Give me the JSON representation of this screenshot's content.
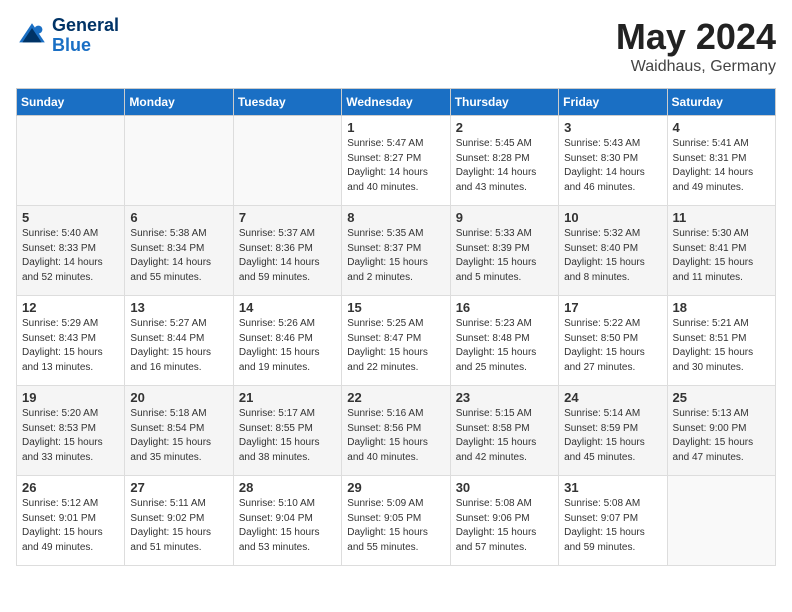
{
  "header": {
    "logo_line1": "General",
    "logo_line2": "Blue",
    "month": "May 2024",
    "location": "Waidhaus, Germany"
  },
  "weekdays": [
    "Sunday",
    "Monday",
    "Tuesday",
    "Wednesday",
    "Thursday",
    "Friday",
    "Saturday"
  ],
  "weeks": [
    [
      {
        "day": "",
        "sunrise": "",
        "sunset": "",
        "daylight": ""
      },
      {
        "day": "",
        "sunrise": "",
        "sunset": "",
        "daylight": ""
      },
      {
        "day": "",
        "sunrise": "",
        "sunset": "",
        "daylight": ""
      },
      {
        "day": "1",
        "sunrise": "Sunrise: 5:47 AM",
        "sunset": "Sunset: 8:27 PM",
        "daylight": "Daylight: 14 hours and 40 minutes."
      },
      {
        "day": "2",
        "sunrise": "Sunrise: 5:45 AM",
        "sunset": "Sunset: 8:28 PM",
        "daylight": "Daylight: 14 hours and 43 minutes."
      },
      {
        "day": "3",
        "sunrise": "Sunrise: 5:43 AM",
        "sunset": "Sunset: 8:30 PM",
        "daylight": "Daylight: 14 hours and 46 minutes."
      },
      {
        "day": "4",
        "sunrise": "Sunrise: 5:41 AM",
        "sunset": "Sunset: 8:31 PM",
        "daylight": "Daylight: 14 hours and 49 minutes."
      }
    ],
    [
      {
        "day": "5",
        "sunrise": "Sunrise: 5:40 AM",
        "sunset": "Sunset: 8:33 PM",
        "daylight": "Daylight: 14 hours and 52 minutes."
      },
      {
        "day": "6",
        "sunrise": "Sunrise: 5:38 AM",
        "sunset": "Sunset: 8:34 PM",
        "daylight": "Daylight: 14 hours and 55 minutes."
      },
      {
        "day": "7",
        "sunrise": "Sunrise: 5:37 AM",
        "sunset": "Sunset: 8:36 PM",
        "daylight": "Daylight: 14 hours and 59 minutes."
      },
      {
        "day": "8",
        "sunrise": "Sunrise: 5:35 AM",
        "sunset": "Sunset: 8:37 PM",
        "daylight": "Daylight: 15 hours and 2 minutes."
      },
      {
        "day": "9",
        "sunrise": "Sunrise: 5:33 AM",
        "sunset": "Sunset: 8:39 PM",
        "daylight": "Daylight: 15 hours and 5 minutes."
      },
      {
        "day": "10",
        "sunrise": "Sunrise: 5:32 AM",
        "sunset": "Sunset: 8:40 PM",
        "daylight": "Daylight: 15 hours and 8 minutes."
      },
      {
        "day": "11",
        "sunrise": "Sunrise: 5:30 AM",
        "sunset": "Sunset: 8:41 PM",
        "daylight": "Daylight: 15 hours and 11 minutes."
      }
    ],
    [
      {
        "day": "12",
        "sunrise": "Sunrise: 5:29 AM",
        "sunset": "Sunset: 8:43 PM",
        "daylight": "Daylight: 15 hours and 13 minutes."
      },
      {
        "day": "13",
        "sunrise": "Sunrise: 5:27 AM",
        "sunset": "Sunset: 8:44 PM",
        "daylight": "Daylight: 15 hours and 16 minutes."
      },
      {
        "day": "14",
        "sunrise": "Sunrise: 5:26 AM",
        "sunset": "Sunset: 8:46 PM",
        "daylight": "Daylight: 15 hours and 19 minutes."
      },
      {
        "day": "15",
        "sunrise": "Sunrise: 5:25 AM",
        "sunset": "Sunset: 8:47 PM",
        "daylight": "Daylight: 15 hours and 22 minutes."
      },
      {
        "day": "16",
        "sunrise": "Sunrise: 5:23 AM",
        "sunset": "Sunset: 8:48 PM",
        "daylight": "Daylight: 15 hours and 25 minutes."
      },
      {
        "day": "17",
        "sunrise": "Sunrise: 5:22 AM",
        "sunset": "Sunset: 8:50 PM",
        "daylight": "Daylight: 15 hours and 27 minutes."
      },
      {
        "day": "18",
        "sunrise": "Sunrise: 5:21 AM",
        "sunset": "Sunset: 8:51 PM",
        "daylight": "Daylight: 15 hours and 30 minutes."
      }
    ],
    [
      {
        "day": "19",
        "sunrise": "Sunrise: 5:20 AM",
        "sunset": "Sunset: 8:53 PM",
        "daylight": "Daylight: 15 hours and 33 minutes."
      },
      {
        "day": "20",
        "sunrise": "Sunrise: 5:18 AM",
        "sunset": "Sunset: 8:54 PM",
        "daylight": "Daylight: 15 hours and 35 minutes."
      },
      {
        "day": "21",
        "sunrise": "Sunrise: 5:17 AM",
        "sunset": "Sunset: 8:55 PM",
        "daylight": "Daylight: 15 hours and 38 minutes."
      },
      {
        "day": "22",
        "sunrise": "Sunrise: 5:16 AM",
        "sunset": "Sunset: 8:56 PM",
        "daylight": "Daylight: 15 hours and 40 minutes."
      },
      {
        "day": "23",
        "sunrise": "Sunrise: 5:15 AM",
        "sunset": "Sunset: 8:58 PM",
        "daylight": "Daylight: 15 hours and 42 minutes."
      },
      {
        "day": "24",
        "sunrise": "Sunrise: 5:14 AM",
        "sunset": "Sunset: 8:59 PM",
        "daylight": "Daylight: 15 hours and 45 minutes."
      },
      {
        "day": "25",
        "sunrise": "Sunrise: 5:13 AM",
        "sunset": "Sunset: 9:00 PM",
        "daylight": "Daylight: 15 hours and 47 minutes."
      }
    ],
    [
      {
        "day": "26",
        "sunrise": "Sunrise: 5:12 AM",
        "sunset": "Sunset: 9:01 PM",
        "daylight": "Daylight: 15 hours and 49 minutes."
      },
      {
        "day": "27",
        "sunrise": "Sunrise: 5:11 AM",
        "sunset": "Sunset: 9:02 PM",
        "daylight": "Daylight: 15 hours and 51 minutes."
      },
      {
        "day": "28",
        "sunrise": "Sunrise: 5:10 AM",
        "sunset": "Sunset: 9:04 PM",
        "daylight": "Daylight: 15 hours and 53 minutes."
      },
      {
        "day": "29",
        "sunrise": "Sunrise: 5:09 AM",
        "sunset": "Sunset: 9:05 PM",
        "daylight": "Daylight: 15 hours and 55 minutes."
      },
      {
        "day": "30",
        "sunrise": "Sunrise: 5:08 AM",
        "sunset": "Sunset: 9:06 PM",
        "daylight": "Daylight: 15 hours and 57 minutes."
      },
      {
        "day": "31",
        "sunrise": "Sunrise: 5:08 AM",
        "sunset": "Sunset: 9:07 PM",
        "daylight": "Daylight: 15 hours and 59 minutes."
      },
      {
        "day": "",
        "sunrise": "",
        "sunset": "",
        "daylight": ""
      }
    ]
  ]
}
